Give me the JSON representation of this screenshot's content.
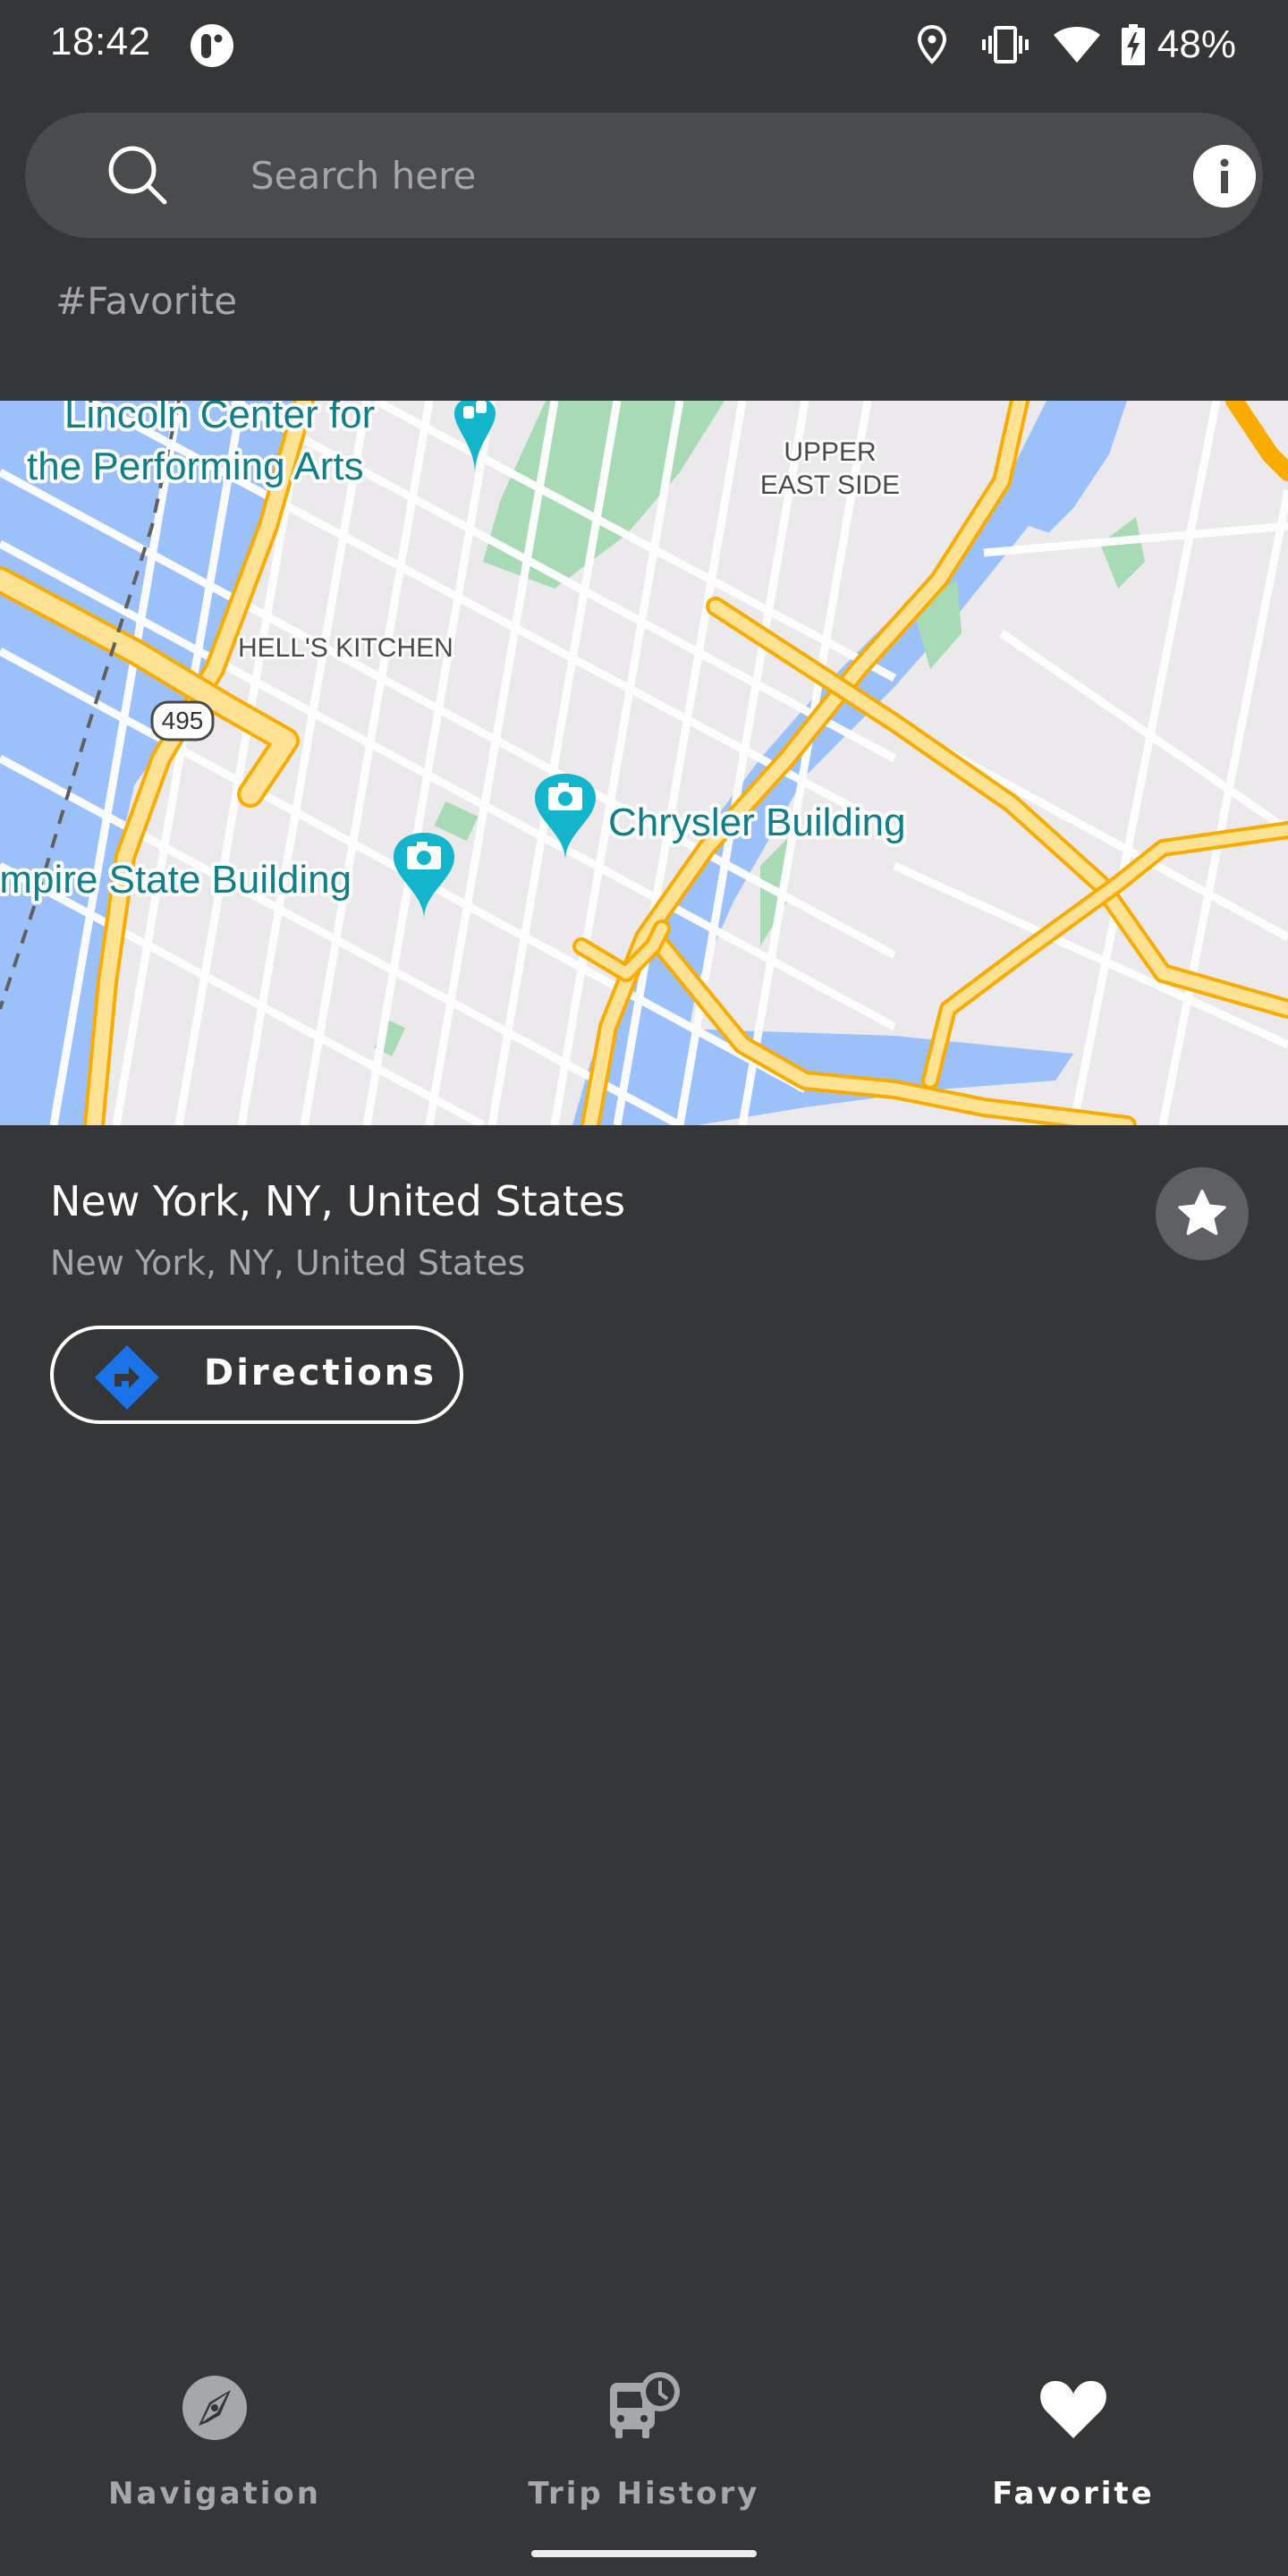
{
  "status_bar": {
    "time": "18:42",
    "app_icon": "app-notification-icon",
    "icons": [
      "location-pin-icon",
      "vibrate-icon",
      "wifi-icon",
      "battery-charging-icon"
    ],
    "battery_percent": "48%"
  },
  "search": {
    "placeholder": "Search here",
    "value": "",
    "search_icon": "search-icon",
    "info_icon": "info-icon"
  },
  "tag": "#Favorite",
  "map": {
    "labels": {
      "lincoln_center_line1": "Lincoln Center for",
      "lincoln_center_line2": "the Performing Arts",
      "hells_kitchen": "HELL'S KITCHEN",
      "upper_east_side_line1": "UPPER",
      "upper_east_side_line2": "EAST SIDE",
      "chrysler": "Chrysler Building",
      "empire_state": "Empire State Building",
      "route_shield": "495"
    },
    "colors": {
      "land": "#ebe9ec",
      "water": "#9cc0f9",
      "park": "#a8dab5",
      "highway": "#f9ab00",
      "highway_fill": "#fde293",
      "street": "#ffffff",
      "poi": "#12b5cb",
      "poi_text": "#0f7f89"
    }
  },
  "place": {
    "title": "New York, NY, United States",
    "subtitle": "New York, NY, United States",
    "favorite_icon": "star-icon",
    "directions_label": "Directions",
    "directions_icon": "directions-icon"
  },
  "bottom_nav": {
    "items": [
      {
        "label": "Navigation",
        "icon": "compass-icon",
        "active": false
      },
      {
        "label": "Trip History",
        "icon": "bus-clock-icon",
        "active": false
      },
      {
        "label": "Favorite",
        "icon": "heart-icon",
        "active": true
      }
    ]
  },
  "colors": {
    "background": "#353638",
    "search_bar": "#4a4b4d",
    "secondary_text": "#a6a7a9",
    "directions_accent": "#1a73e8",
    "star_button": "#5f6063"
  }
}
